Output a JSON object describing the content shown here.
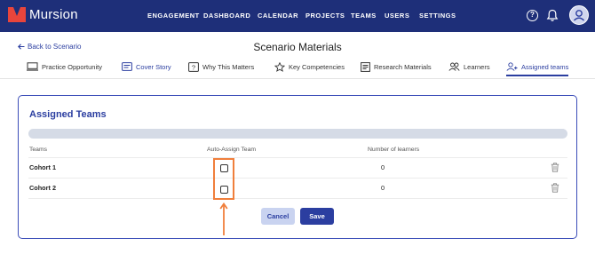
{
  "app": {
    "logo_text": "Mursion",
    "nav": [
      "ENGAGEMENT",
      "DASHBOARD",
      "CALENDAR",
      "PROJECTS",
      "TEAMS",
      "USERS",
      "SETTINGS"
    ],
    "help_glyph": "?"
  },
  "header": {
    "back_label": "Back to Scenario",
    "title": "Scenario Materials"
  },
  "tabs": [
    {
      "label": "Practice Opportunity",
      "icon": "monitor-icon"
    },
    {
      "label": "Cover Story",
      "icon": "id-card-icon"
    },
    {
      "label": "Why This Matters",
      "icon": "question-box-icon"
    },
    {
      "label": "Key Competencies",
      "icon": "star-icon"
    },
    {
      "label": "Research Materials",
      "icon": "document-icon"
    },
    {
      "label": "Learners",
      "icon": "people-icon"
    },
    {
      "label": "Assigned teams",
      "icon": "team-icon",
      "active": true
    }
  ],
  "card": {
    "title": "Assigned Teams",
    "columns": [
      "Teams",
      "Auto-Assign Team",
      "Number of learners"
    ],
    "rows": [
      {
        "team": "Cohort 1",
        "auto_assign": false,
        "learners": "0"
      },
      {
        "team": "Cohort 2",
        "auto_assign": false,
        "learners": "0"
      }
    ],
    "cancel_label": "Cancel",
    "save_label": "Save"
  },
  "colors": {
    "nav_bg": "#1e2f79",
    "accent": "#2b3ea0",
    "logo_red": "#e8453c",
    "highlight": "#f07f3c"
  }
}
